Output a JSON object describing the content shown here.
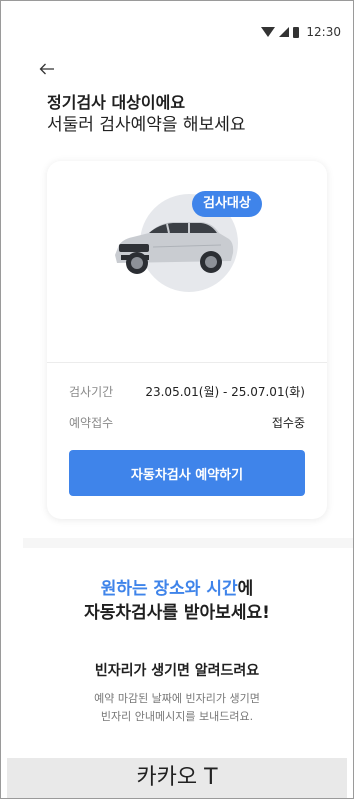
{
  "status_bar": {
    "time": "12:30"
  },
  "header": {
    "back_icon": "arrow-left-icon"
  },
  "headline": {
    "title": "정기검사 대상이에요",
    "subtitle": "서둘러 검사예약을 해보세요"
  },
  "card": {
    "badge": "검사대상",
    "period_label": "검사기간",
    "period_value": "23.05.01(월) - 25.07.01(화)",
    "reception_label": "예약접수",
    "reception_value": "접수중",
    "reserve_button": "자동차검사 예약하기"
  },
  "promo": {
    "highlight": "원하는 장소와 시간",
    "title_rest_line1": "에",
    "title_line2": "자동차검사를 받아보세요!"
  },
  "notify": {
    "title": "빈자리가 생기면 알려드려요",
    "desc_line1": "예약 마감된 날짜에 빈자리가 생기면",
    "desc_line2": "빈자리 안내메시지를 보내드려요."
  },
  "footer": {
    "label": "카카오 T"
  },
  "colors": {
    "accent": "#3f84ea",
    "badge_bg": "#3f84ea"
  }
}
